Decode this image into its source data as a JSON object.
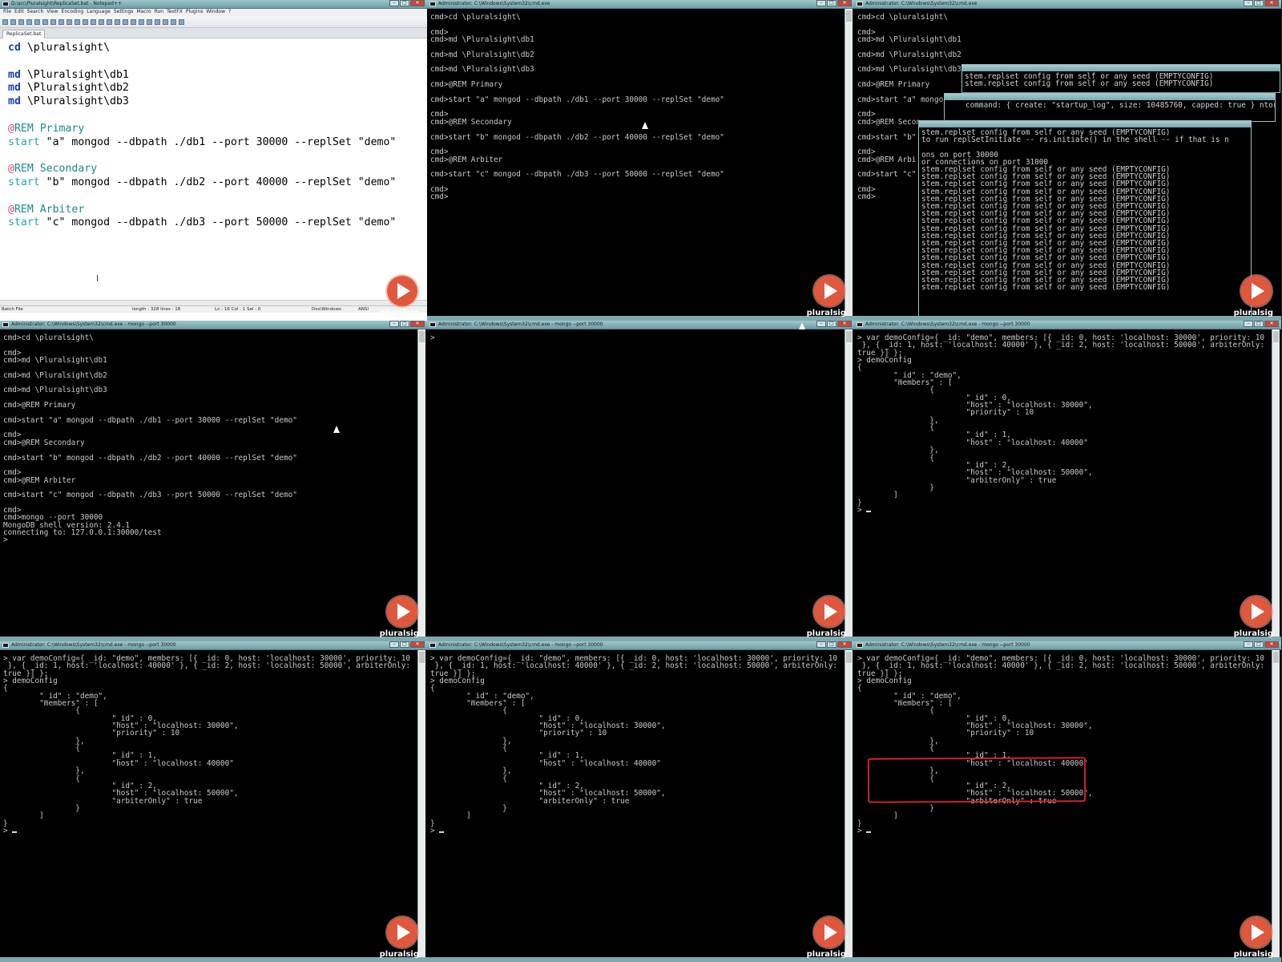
{
  "notepad": {
    "title": "D:\\src\\Pluralsight\\ReplicaSet.bat - Notepad++",
    "menu": [
      "File",
      "Edit",
      "Search",
      "View",
      "Encoding",
      "Language",
      "Settings",
      "Macro",
      "Run",
      "TextFX",
      "Plugins",
      "Window",
      "?"
    ],
    "tab": "ReplicaSet.bat",
    "code": {
      "cd": "cd \\pluralsight\\",
      "md1": "md \\Pluralsight\\db1",
      "md2": "md \\Pluralsight\\db2",
      "md3": "md \\Pluralsight\\db3",
      "rem_primary": "REM Primary",
      "start_a": "\"a\" mongod --dbpath ./db1 --port 30000 --replSet \"demo\"",
      "rem_secondary": "REM Secondary",
      "start_b": "\"b\" mongod --dbpath ./db2 --port 40000 --replSet \"demo\"",
      "rem_arbiter": "REM Arbiter",
      "start_c": "\"c\" mongod --dbpath ./db3 --port 50000 --replSet \"demo\"",
      "kw_cd": "cd",
      "kw_md": "md",
      "kw_at": "@",
      "kw_start": "start"
    },
    "status": {
      "filetype": "Batch File",
      "length": "length : 328    lines : 18",
      "position": "Ln : 16    Col : 1    Sel : 0",
      "eol": "Dos\\Windows",
      "encoding": "ANSI"
    }
  },
  "titles": {
    "cmd": "Administrator: C:\\Windows\\System32\\cmd.exe",
    "mongo": "Administrator: C:\\Windows\\System32\\cmd.exe - mongo  --port 30000"
  },
  "terminals": {
    "batch_run": "cmd>cd \\pluralsight\\\n\ncmd>\ncmd>md \\Pluralsight\\db1\n\ncmd>md \\Pluralsight\\db2\n\ncmd>md \\Pluralsight\\db3\n\ncmd>@REM Primary\n\ncmd>start \"a\" mongod --dbpath ./db1 --port 30000 --replSet \"demo\"\n\ncmd>\ncmd>@REM Secondary\n\ncmd>start \"b\" mongod --dbpath ./db2 --port 40000 --replSet \"demo\"\n\ncmd>\ncmd>@REM Arbiter\n\ncmd>start \"c\" mongod --dbpath ./db3 --port 50000 --replSet \"demo\"\n\ncmd>\ncmd>",
    "batch_bg": "cmd>cd \\pluralsight\\\n\ncmd>\ncmd>md \\Pluralsight\\db1\n\ncmd>md \\Pluralsight\\db2\n\ncmd>md \\Pluralsight\\db3\n\ncmd>@REM Primary\n\ncmd>start \"a\" mongo\n\ncmd>\ncmd>@REM Secon\n\ncmd>start \"b\"\n\ncmd>\ncmd>@REM Arbi\n\ncmd>start \"c\"\n\ncmd>\ncmd>",
    "overlay1": "stem.replset config from self or any seed (EMPTYCONFIG)\nstem.replset config from self or any seed (EMPTYCONFIG)",
    "overlay2": "command: { create: \"startup_log\", size: 10485760, capped: true } ntor",
    "overlay3": "stem.replset config from self or any seed (EMPTYCONFIG)\nto run replSetInitiate -- rs.initiate() in the shell -- if that is n\n\nons on port 30000\nor connections on port 31000\nstem.replset config from self or any seed (EMPTYCONFIG)\nstem.replset config from self or any seed (EMPTYCONFIG)\nstem.replset config from self or any seed (EMPTYCONFIG)\nstem.replset config from self or any seed (EMPTYCONFIG)\nstem.replset config from self or any seed (EMPTYCONFIG)\nstem.replset config from self or any seed (EMPTYCONFIG)\nstem.replset config from self or any seed (EMPTYCONFIG)\nstem.replset config from self or any seed (EMPTYCONFIG)\nstem.replset config from self or any seed (EMPTYCONFIG)\nstem.replset config from self or any seed (EMPTYCONFIG)\nstem.replset config from self or any seed (EMPTYCONFIG)\nstem.replset config from self or any seed (EMPTYCONFIG)\nstem.replset config from self or any seed (EMPTYCONFIG)\nstem.replset config from self or any seed (EMPTYCONFIG)\nstem.replset config from self or any seed (EMPTYCONFIG)\nstem.replset config from self or any seed (EMPTYCONFIG)\nstem.replset config from self or any seed (EMPTYCONFIG)",
    "mongo_connect": "cmd>cd \\pluralsight\\\n\ncmd>\ncmd>md \\Pluralsight\\db1\n\ncmd>md \\Pluralsight\\db2\n\ncmd>md \\Pluralsight\\db3\n\ncmd>@REM Primary\n\ncmd>start \"a\" mongod --dbpath ./db1 --port 30000 --replSet \"demo\"\n\ncmd>\ncmd>@REM Secondary\n\ncmd>start \"b\" mongod --dbpath ./db2 --port 40000 --replSet \"demo\"\n\ncmd>\ncmd>@REM Arbiter\n\ncmd>start \"c\" mongod --dbpath ./db3 --port 50000 --replSet \"demo\"\n\ncmd>\ncmd>mongo --port 30000\nMongoDB shell version: 2.4.1\nconnecting to: 127.0.0.1:30000/test\n>",
    "empty_prompt": ">",
    "democonfig": "> var demoConfig={ _id: \"demo\", members: [{ _id: 0, host: 'localhost: 30000', priority: 10\n }, { _id: 1, host: 'localhost: 40000' }, { _id: 2, host: 'localhost: 50000', arbiterOnly:\ntrue }] };\n> demoConfig\n{\n        \"_id\" : \"demo\",\n        \"members\" : [\n                {\n                        \"_id\" : 0,\n                        \"host\" : \"localhost: 30000\",\n                        \"priority\" : 10\n                },\n                {\n                        \"_id\" : 1,\n                        \"host\" : \"localhost: 40000\"\n                },\n                {\n                        \"_id\" : 2,\n                        \"host\" : \"localhost: 50000\",\n                        \"arbiterOnly\" : true\n                }\n        ]\n}\n> "
  },
  "brand": {
    "watermark": "pluralsig",
    "accent": "#e0573f"
  },
  "highlight_color": "#d0222e"
}
